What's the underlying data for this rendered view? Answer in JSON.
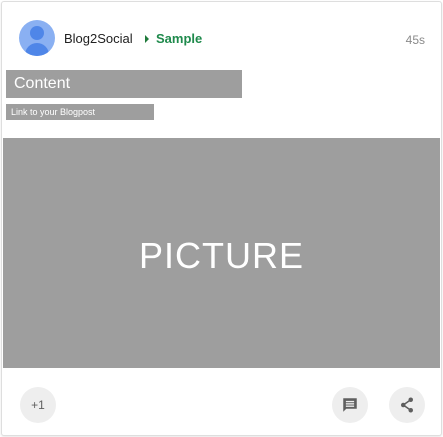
{
  "post": {
    "author": "Blog2Social",
    "community": "Sample",
    "time": "45s",
    "content_title": "Content",
    "link_text": "Link to your Blogpost",
    "picture_label": "PICTURE"
  },
  "actions": {
    "plus_one_label": "+1",
    "comment_icon": "comment-icon",
    "share_icon": "share-icon"
  },
  "colors": {
    "placeholder_gray": "#9e9e9e",
    "community_green": "#1f8a4c",
    "avatar_blue": "#4f86e8"
  }
}
